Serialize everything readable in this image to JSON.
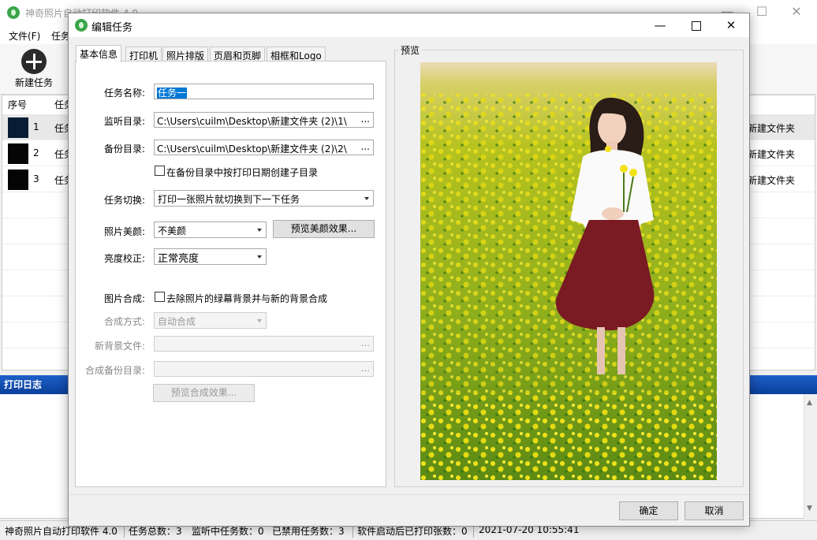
{
  "main_window": {
    "title": "神奇照片自动打印软件 4.0",
    "menu": [
      "文件(F)",
      "任务"
    ],
    "toolbar": {
      "new_task_label": "新建任务"
    },
    "table": {
      "headers": [
        "序号",
        "任务"
      ],
      "rows": [
        {
          "index": "1",
          "name": "任务",
          "folder": "新建文件夹",
          "thumb_color": "#071d33"
        },
        {
          "index": "2",
          "name": "任务",
          "folder": "新建文件夹",
          "thumb_color": "#050505"
        },
        {
          "index": "3",
          "name": "任务",
          "folder": "新建文件夹",
          "thumb_color": "#050505"
        }
      ]
    },
    "log_title": "打印日志",
    "status": {
      "app_name": "神奇照片自动打印软件 4.0",
      "total_tasks": "任务总数：3",
      "monitoring": "监听中任务数：0",
      "disabled": "已禁用任务数：3",
      "printed": "软件启动后已打印张数：0",
      "time": "2021-07-20 10:55:41"
    }
  },
  "dialog": {
    "title": "编辑任务",
    "tabs": [
      "基本信息",
      "打印机",
      "照片排版",
      "页眉和页脚",
      "相框和Logo"
    ],
    "active_tab": 0,
    "form": {
      "task_name_label": "任务名称:",
      "task_name_value": "任务一",
      "watch_dir_label": "监听目录:",
      "watch_dir_value": "C:\\Users\\cuilm\\Desktop\\新建文件夹 (2)\\1\\",
      "backup_dir_label": "备份目录:",
      "backup_dir_value": "C:\\Users\\cuilm\\Desktop\\新建文件夹 (2)\\2\\",
      "date_subdir_label": "在备份目录中按打印日期创建子目录",
      "date_subdir_checked": false,
      "task_switch_label": "任务切换:",
      "task_switch_value": "打印一张照片就切换到下一下任务",
      "beauty_label": "照片美颜:",
      "beauty_value": "不美颜",
      "beauty_preview_button": "预览美颜效果...",
      "brightness_label": "亮度校正:",
      "brightness_value": "正常亮度",
      "composite_label": "图片合成:",
      "composite_checkbox_label": "去除照片的绿幕背景并与新的背景合成",
      "composite_checked": false,
      "composite_mode_label": "合成方式:",
      "composite_mode_value": "自动合成",
      "new_bg_label": "新背景文件:",
      "new_bg_value": "",
      "composite_backup_label": "合成备份目录:",
      "composite_backup_value": "",
      "composite_preview_button": "预览合成效果...",
      "browse_label": "..."
    },
    "preview_label": "预览",
    "ok_label": "确定",
    "cancel_label": "取消",
    "colors": {
      "selection": "#0078d7",
      "accent_green": "#3aa54a"
    }
  }
}
